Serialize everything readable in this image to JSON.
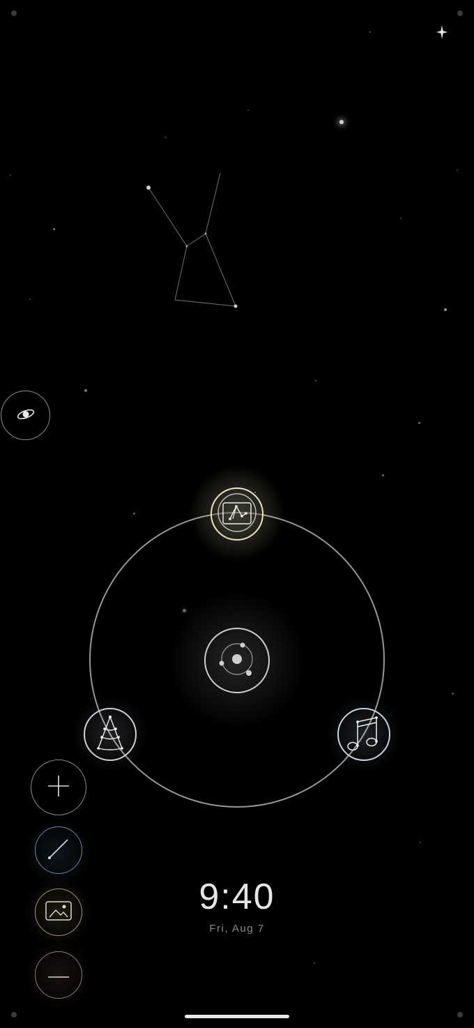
{
  "lockscreen": {
    "time": "9:40",
    "date": "Fri, Aug 7"
  },
  "top_right_button": {
    "icon": "sparkle-star-icon"
  },
  "left_edge_button": {
    "icon": "planet-orbit-icon"
  },
  "radial_menu": {
    "center": {
      "icon": "solar-system-icon"
    },
    "items": [
      {
        "id": "photo-constellation",
        "icon": "photo-constellation-icon",
        "selected": true
      },
      {
        "id": "tree-constellation",
        "icon": "tree-constellation-icon",
        "selected": false
      },
      {
        "id": "music-constellation",
        "icon": "music-note-constellation-icon",
        "selected": false
      }
    ]
  },
  "side_toolbar": [
    {
      "id": "add",
      "icon": "plus-icon"
    },
    {
      "id": "draw-line",
      "icon": "line-pen-icon"
    },
    {
      "id": "image",
      "icon": "image-icon"
    },
    {
      "id": "remove",
      "icon": "minus-icon"
    }
  ],
  "colors": {
    "background": "#000000",
    "ring": "#bdbdbd",
    "selected_glow": "#fff9c4",
    "star": "#cfcfcf"
  }
}
